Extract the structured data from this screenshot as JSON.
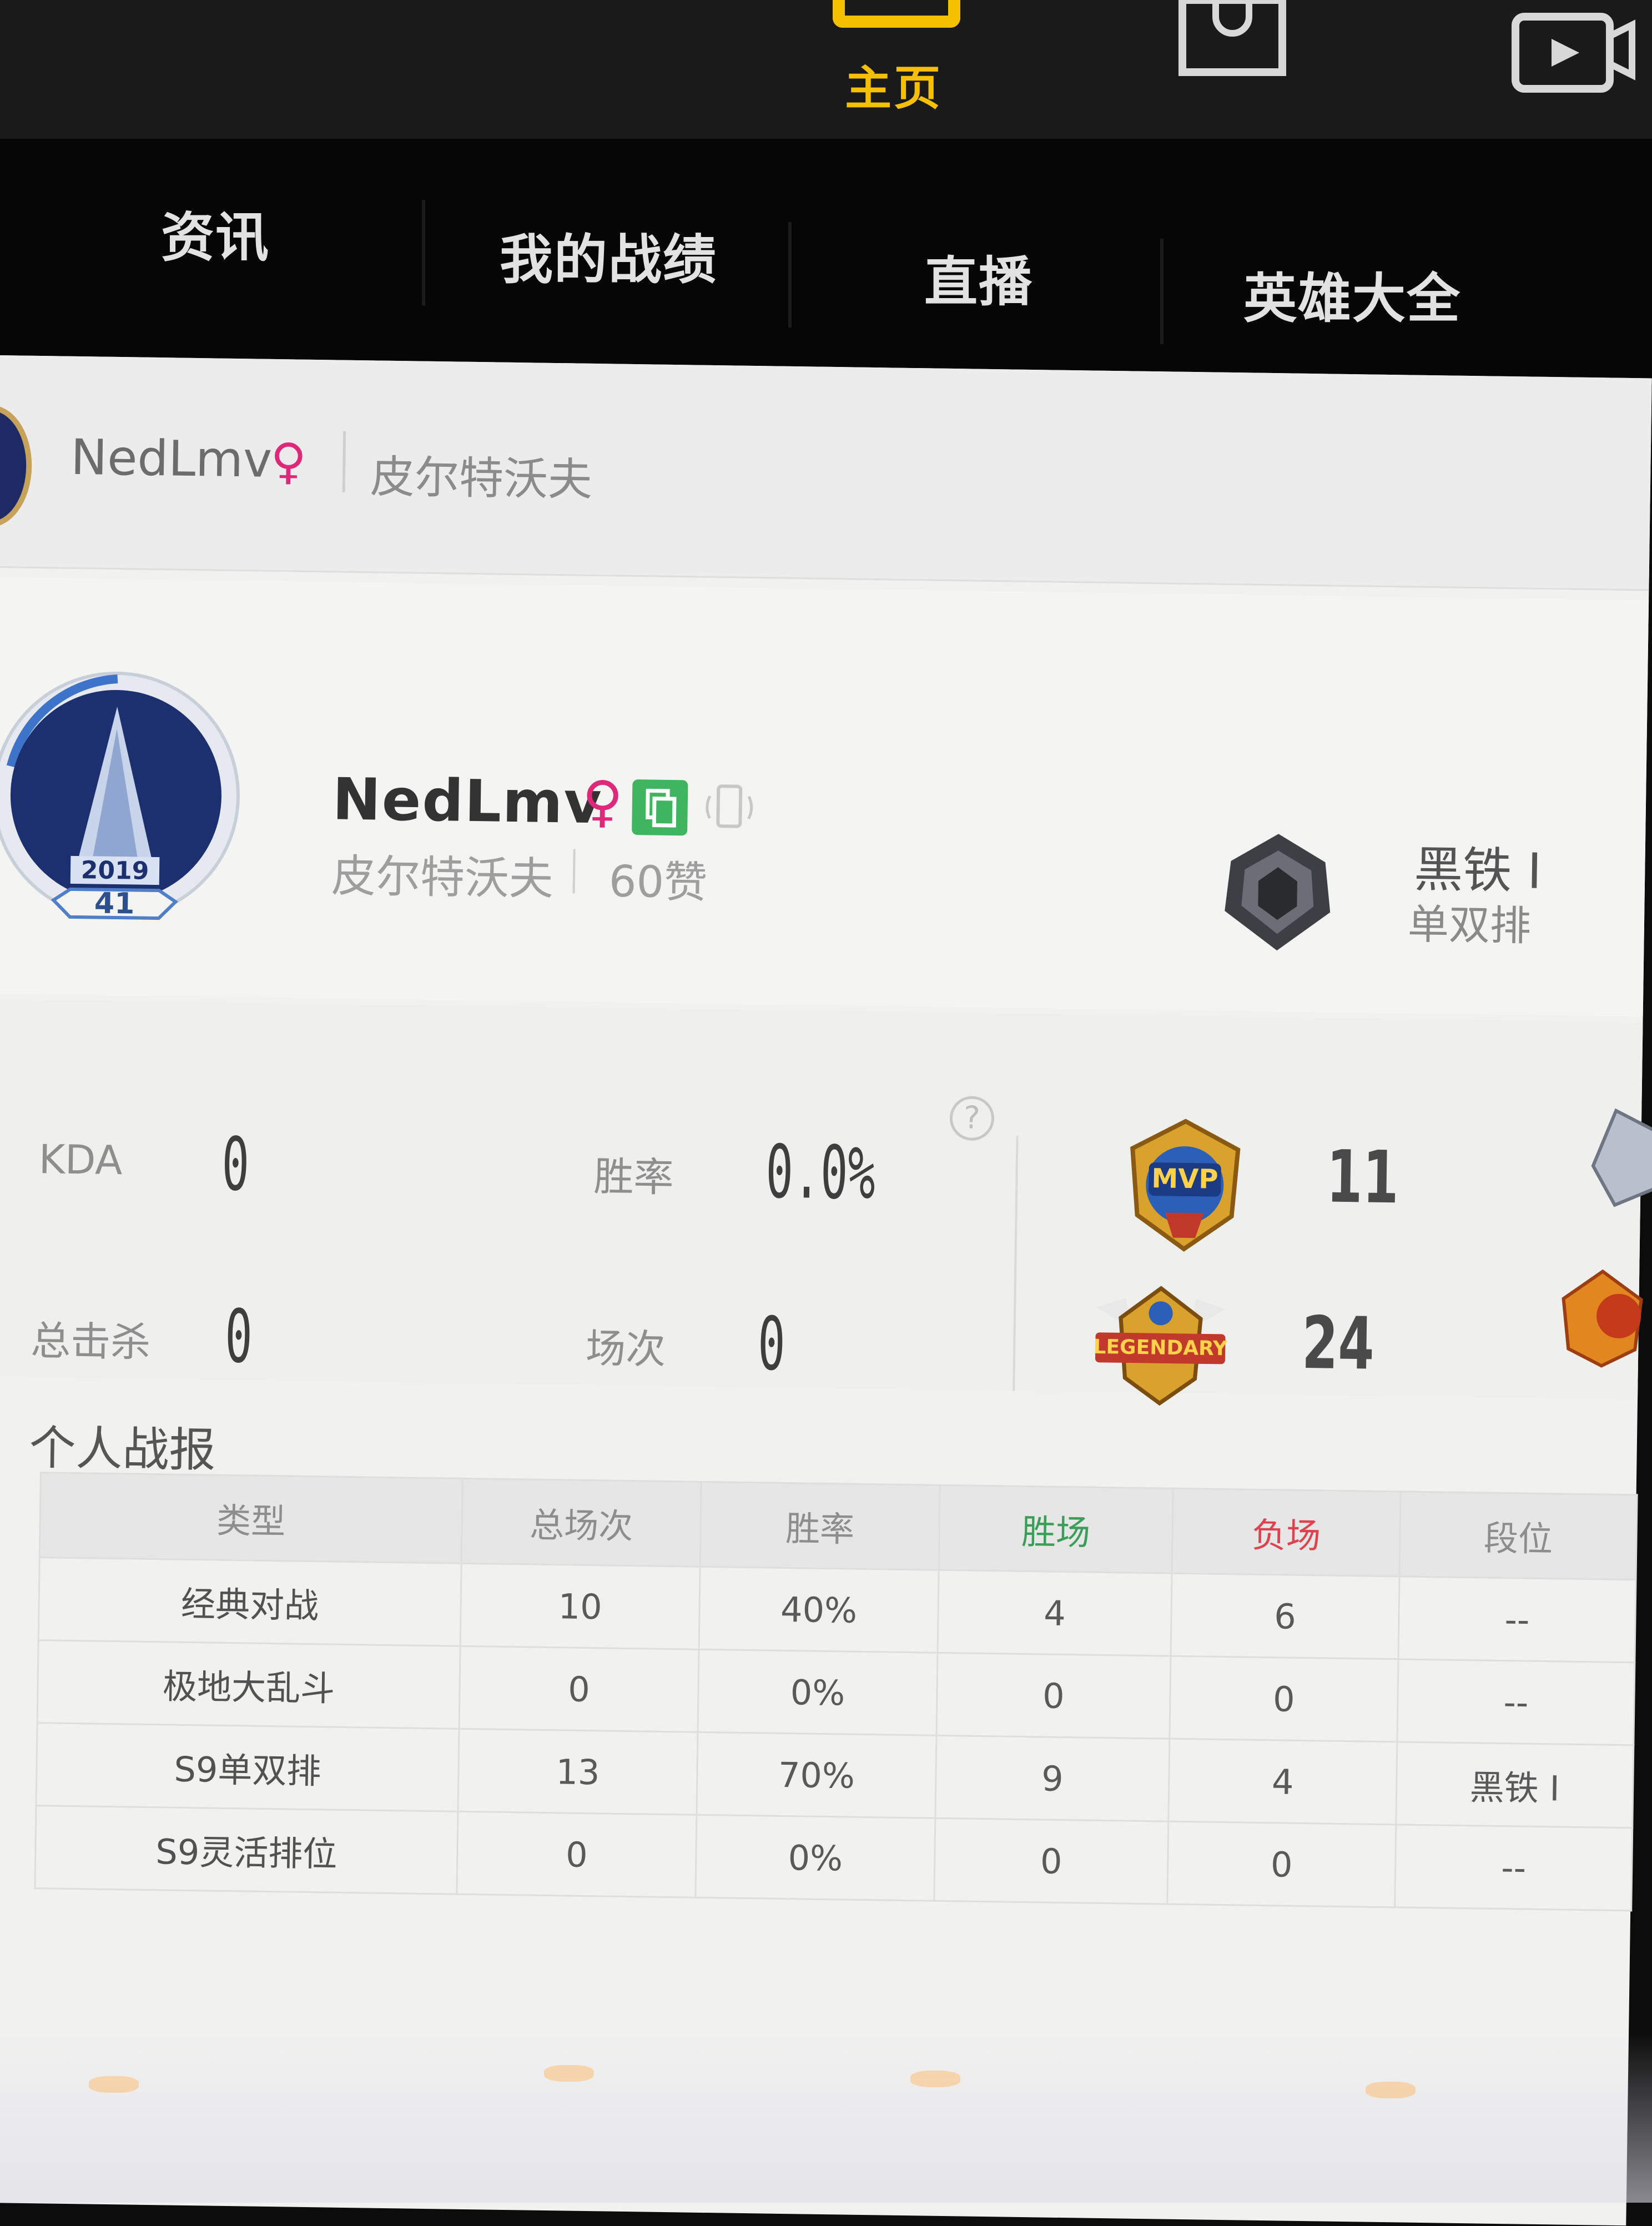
{
  "topbar": {
    "home_label": "主页",
    "icons": [
      "home-icon",
      "shopping-bag-icon",
      "video-icon"
    ],
    "accent_color": "#f5c000"
  },
  "nav": {
    "tabs": [
      {
        "label": "资讯"
      },
      {
        "label": "我的战绩"
      },
      {
        "label": "直播"
      },
      {
        "label": "英雄大全"
      }
    ]
  },
  "subheader": {
    "name": "NedLmv",
    "gender_symbol": "♀",
    "server": "皮尔特沃夫"
  },
  "profile": {
    "name": "NedLmv",
    "gender_symbol": "♀",
    "server": "皮尔特沃夫",
    "likes": "60赞",
    "badge_year": "2019",
    "level": "41",
    "rank": "黑铁 I",
    "rank_queue": "单双排"
  },
  "stats": {
    "kda_label": "KDA",
    "kda_value": "0",
    "winrate_label": "胜率",
    "winrate_value": "0.0%",
    "kills_label": "总击杀",
    "kills_value": "0",
    "games_label": "场次",
    "games_value": "0",
    "help_symbol": "?",
    "mvp_badge_text": "MVP",
    "mvp_count": "11",
    "legendary_badge_text": "LEGENDARY",
    "legendary_count": "24"
  },
  "report": {
    "title": "个人战报",
    "headers": [
      "类型",
      "总场次",
      "胜率",
      "胜场",
      "负场",
      "段位"
    ],
    "rows": [
      [
        "经典对战",
        "10",
        "40%",
        "4",
        "6",
        "--"
      ],
      [
        "极地大乱斗",
        "0",
        "0%",
        "0",
        "0",
        "--"
      ],
      [
        "S9单双排",
        "13",
        "70%",
        "9",
        "4",
        "黑铁 I"
      ],
      [
        "S9灵活排位",
        "0",
        "0%",
        "0",
        "0",
        "--"
      ]
    ],
    "win_color": "#3a9e58",
    "lose_color": "#e0414e"
  }
}
